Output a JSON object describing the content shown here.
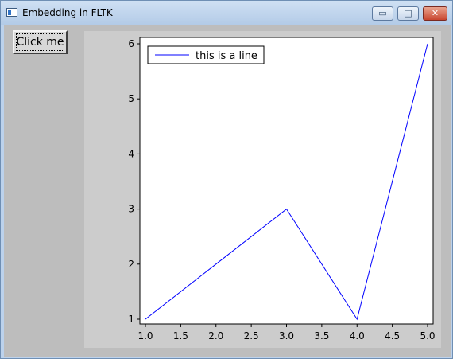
{
  "window": {
    "title": "Embedding in FLTK"
  },
  "titlebar_buttons": {
    "minimize": "▭",
    "maximize": "□",
    "close": "✕"
  },
  "button": {
    "label": "Click me"
  },
  "chart_data": {
    "type": "line",
    "x": [
      1.0,
      2.0,
      3.0,
      4.0,
      5.0
    ],
    "series": [
      {
        "name": "this is a line",
        "values": [
          1,
          2,
          3,
          1,
          6
        ],
        "color": "#0000ff"
      }
    ],
    "xlim": [
      1.0,
      5.0
    ],
    "ylim": [
      1,
      6
    ],
    "xticks": [
      "1.0",
      "1.5",
      "2.0",
      "2.5",
      "3.0",
      "3.5",
      "4.0",
      "4.5",
      "5.0"
    ],
    "yticks": [
      "1",
      "2",
      "3",
      "4",
      "5",
      "6"
    ],
    "grid": false,
    "legend_position": "top-left"
  }
}
